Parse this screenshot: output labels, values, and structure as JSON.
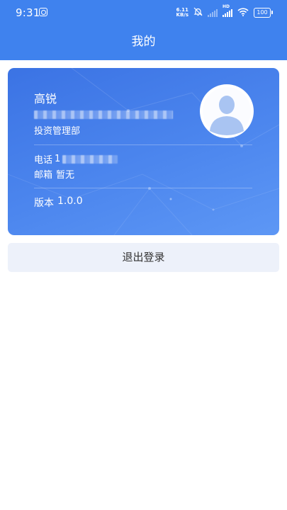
{
  "status_bar": {
    "time": "9:31",
    "net_speed_value": "6.11",
    "net_speed_unit": "KB/s",
    "hd_label": "HD",
    "battery": "100"
  },
  "header": {
    "title": "我的"
  },
  "profile": {
    "name": "高锐",
    "department": "投资管理部",
    "phone_label": "电话",
    "phone_visible_prefix": "1",
    "email_label": "邮箱",
    "email_value": "暂无",
    "version_label": "版本",
    "version_value": "1.0.0"
  },
  "actions": {
    "logout_label": "退出登录"
  },
  "colors": {
    "primary": "#3f82ee",
    "card_start": "#3b73e4",
    "card_end": "#5d97f5",
    "logout_bg": "#edf1fa"
  }
}
